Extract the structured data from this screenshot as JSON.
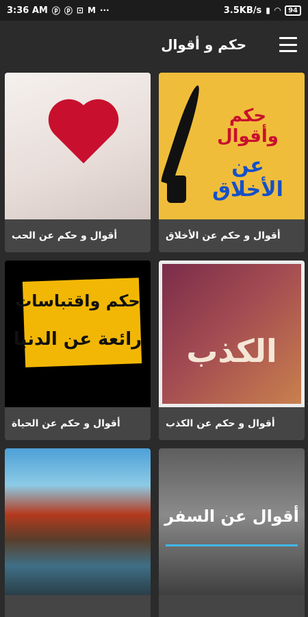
{
  "status_bar": {
    "time": "3:36 AM",
    "left_icons": [
      "p-icon",
      "p-icon",
      "clock-icon",
      "gmail-icon",
      "more-icon"
    ],
    "speed": "3.5KB/s",
    "battery": "94"
  },
  "app_bar": {
    "title": "حكم و أقوال",
    "menu_icon": "menu-icon"
  },
  "cards": [
    {
      "label": "أقوال و حكم عن الأخلاق",
      "thumb_lines": [
        "حكم وأقوال",
        "عن الأخلاق"
      ]
    },
    {
      "label": "أقوال و حكم عن الحب",
      "thumb_lines": []
    },
    {
      "label": "أقوال و حكم عن الكذب",
      "thumb_lines": [
        "الكذب"
      ]
    },
    {
      "label": "أقوال و حكم عن الحياة",
      "thumb_lines": [
        "حكم واقتباسات",
        "رائعة عن الدنيا"
      ]
    },
    {
      "label": "",
      "thumb_lines": [
        "أقوال عن السفر"
      ]
    },
    {
      "label": "",
      "thumb_lines": []
    }
  ]
}
